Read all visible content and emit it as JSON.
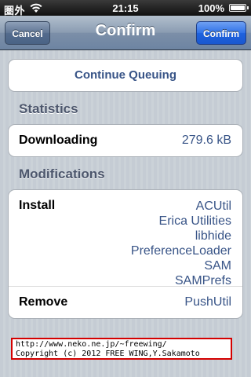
{
  "status_bar": {
    "carrier": "圏外",
    "time": "21:15",
    "battery": "100%",
    "battery_level": 1.0,
    "wifi_icon": "wifi-icon",
    "battery_icon": "battery-icon"
  },
  "nav": {
    "title": "Confirm",
    "cancel_label": "Cancel",
    "confirm_label": "Confirm"
  },
  "actions": {
    "continue_label": "Continue Queuing"
  },
  "statistics": {
    "header": "Statistics",
    "downloading_label": "Downloading",
    "downloading_value": "279.6 kB"
  },
  "modifications": {
    "header": "Modifications",
    "install_label": "Install",
    "install_items": [
      "ACUtil",
      "Erica Utilities",
      "libhide",
      "PreferenceLoader",
      "SAM",
      "SAMPrefs"
    ],
    "remove_label": "Remove",
    "remove_items": [
      "PushUtil"
    ]
  },
  "credit": {
    "line1": "http://www.neko.ne.jp/~freewing/",
    "line2": "Copyright (c) 2012 FREE WING,Y.Sakamoto"
  },
  "colors": {
    "value_blue": "#385487",
    "confirm_blue": "#1e62de",
    "nav_steel": "#6d84a2",
    "credit_border": "#d40000"
  }
}
